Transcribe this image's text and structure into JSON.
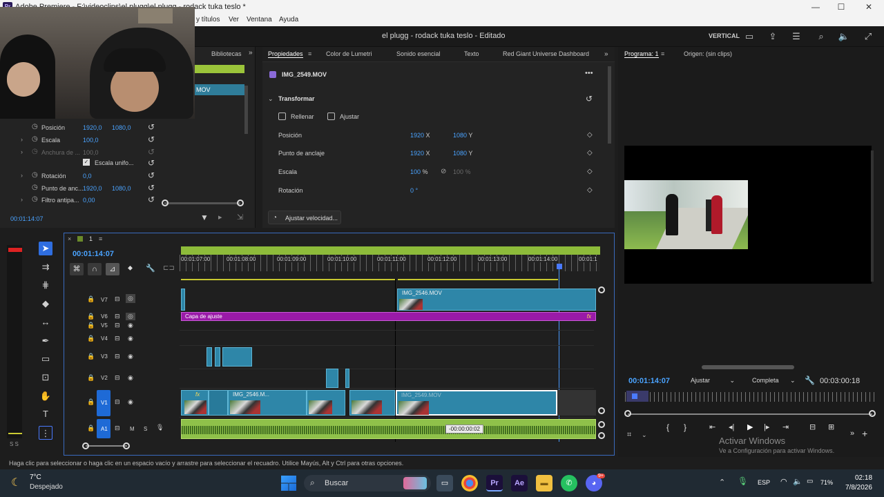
{
  "titlebar": {
    "text": "Adobe Premiere - F:\\videoclips\\el plugg\\el plugg - rodack tuka teslo *",
    "app_icon": "Pr",
    "min": "—",
    "max": "☐",
    "close": "✕"
  },
  "menubar": {
    "items": [
      "y títulos",
      "Ver",
      "Ventana",
      "Ayuda"
    ]
  },
  "header": {
    "project_title": "el plugg - rodack tuka teslo - Editado",
    "workspace": "VERTICAL"
  },
  "left_panel": {
    "tab_bibliotecas": "Bibliotecas",
    "clip_partial": "MOV",
    "rows": [
      {
        "label": "Posición",
        "v1": "1920,0",
        "v2": "1080,0"
      },
      {
        "label": "Escala",
        "v1": "100,0",
        "v2": ""
      },
      {
        "label": "Anchura de ...",
        "v1": "100,0",
        "v2": ""
      },
      {
        "label": "Escala unifo...",
        "v1": "",
        "v2": ""
      },
      {
        "label": "Rotación",
        "v1": "0,0",
        "v2": ""
      },
      {
        "label": "Punto de anc...",
        "v1": "1920,0",
        "v2": "1080,0"
      },
      {
        "label": "Filtro antipa...",
        "v1": "0,00",
        "v2": ""
      }
    ],
    "timecode": "00:01:14:07"
  },
  "properties": {
    "tabs": [
      "Propiedades",
      "Color de Lumetri",
      "Sonido esencial",
      "Texto",
      "Red Giant Universe Dashboard"
    ],
    "clip_name": "IMG_2549.MOV",
    "section": "Transformar",
    "fill_label": "Rellenar",
    "fit_label": "Ajustar",
    "rows": [
      {
        "label": "Posición",
        "x": "1920",
        "xu": "X",
        "y": "1080",
        "yu": "Y"
      },
      {
        "label": "Punto de anclaje",
        "x": "1920",
        "xu": "X",
        "y": "1080",
        "yu": "Y"
      },
      {
        "label": "Escala",
        "x": "100",
        "xu": "%",
        "y": "100 %",
        "yu": ""
      },
      {
        "label": "Rotación",
        "x": "0 °",
        "xu": "",
        "y": "",
        "yu": ""
      }
    ],
    "speed_button": "Ajustar velocidad..."
  },
  "program": {
    "tab_program": "Programa: 1",
    "tab_source": "Origen: (sin clips)",
    "timecode": "00:01:14:07",
    "fit": "Ajustar",
    "quality": "Completa",
    "duration": "00:03:00:18",
    "watermark_title": "Activar Windows",
    "watermark_sub": "Ve a Configuración para activar Windows."
  },
  "timeline": {
    "seq_number": "1",
    "timecode": "00:01:14:07",
    "ruler": [
      "00:01:07:00",
      "00:01:08:00",
      "00:01:09:00",
      "00:01:10:00",
      "00:01:11:00",
      "00:01:12:00",
      "00:01:13:00",
      "00:01:14:00",
      "00:01:1"
    ],
    "tracks": [
      "V7",
      "V6",
      "V5",
      "V4",
      "V3",
      "V2",
      "V1",
      "A1"
    ],
    "clip_v7": "IMG_2546.MOV",
    "adjust_layer": "Capa de ajuste",
    "clip_v1a": "IMG_2546.M...",
    "clip_v1b": "IMG_2549.MOV",
    "offset_tooltip": "-00:00:00:02",
    "fx": "fx",
    "m": "M",
    "s": "S"
  },
  "meter": {
    "label": "S S"
  },
  "status": {
    "text": "Haga clic para seleccionar o haga clic en un espacio vacío y arrastre para seleccionar el recuadro. Utilice Mayús, Alt y Ctrl para otras opciones."
  },
  "taskbar": {
    "temp": "7°C",
    "weather": "Despejado",
    "search": "Buscar",
    "lang": "ESP",
    "battery": "71%",
    "time": "02:18",
    "date": "7/8/2026",
    "discord_badge": "9+"
  }
}
